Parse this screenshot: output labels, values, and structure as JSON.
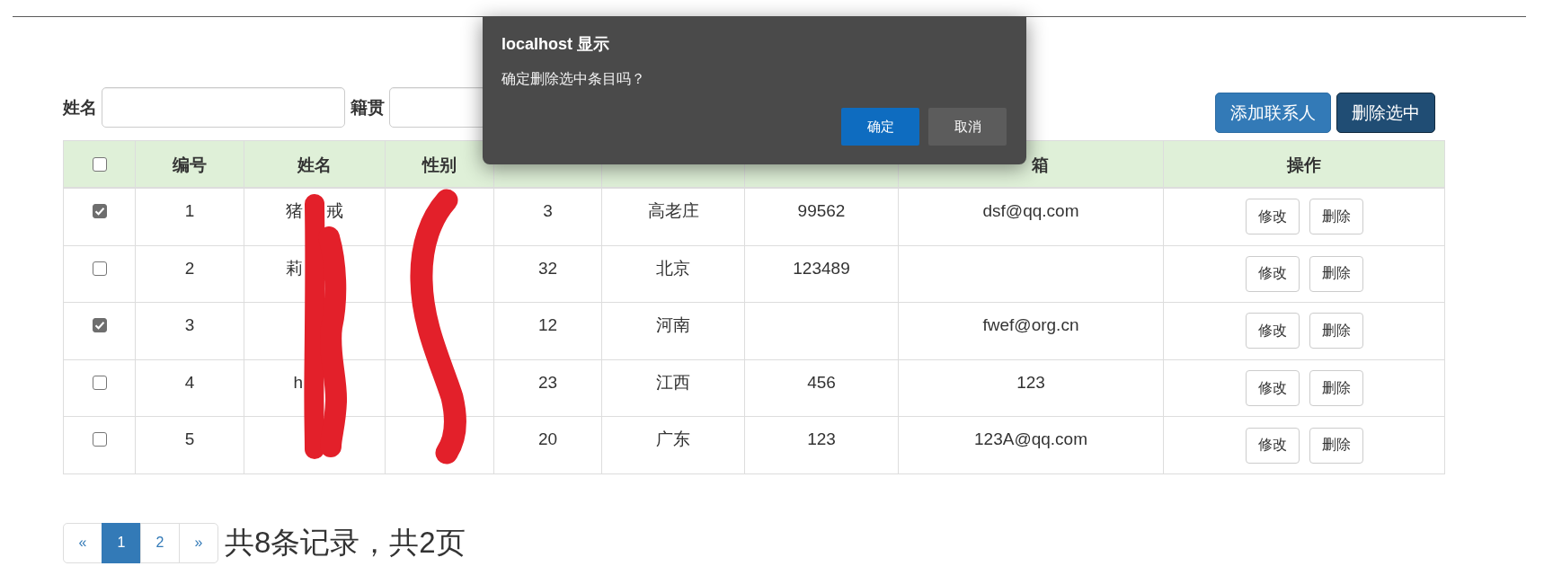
{
  "search_form": {
    "fields": [
      {
        "label": "姓名"
      },
      {
        "label": "籍贯"
      }
    ]
  },
  "toolbar": {
    "buttons": [
      {
        "label": "添加联系人",
        "pressed": false
      },
      {
        "label": "删除选中",
        "pressed": true
      }
    ]
  },
  "table": {
    "columns": [
      {
        "kind": "checkbox",
        "checked": false,
        "redacted": false
      },
      {
        "kind": "text",
        "label": "编号",
        "redacted": false
      },
      {
        "kind": "text",
        "label": "姓名",
        "redacted": true
      },
      {
        "kind": "text",
        "label": "性别",
        "redacted": true
      },
      {
        "kind": "text",
        "redacted": false
      },
      {
        "kind": "text",
        "redacted": false
      },
      {
        "kind": "text",
        "redacted": false
      },
      {
        "kind": "text",
        "label": "箱",
        "redacted": false
      },
      {
        "kind": "text",
        "label": "操作",
        "redacted": false
      }
    ],
    "rows": [
      {
        "selected": true,
        "number": "1",
        "name": {
          "visible_left": "猪",
          "visible_right": "戒"
        },
        "age": "3",
        "hometown": "高老庄",
        "qq": "99562",
        "email": "dsf@qq.com",
        "actions": [
          "修改",
          "删除"
        ]
      },
      {
        "selected": false,
        "number": "2",
        "name": {
          "visible_left": "莉"
        },
        "age": "32",
        "hometown": "北京",
        "qq": "123489",
        "actions": [
          "修改",
          "删除"
        ]
      },
      {
        "selected": true,
        "number": "3",
        "age": "12",
        "hometown": "河南",
        "email": "fwef@org.cn",
        "actions": [
          "修改",
          "删除"
        ]
      },
      {
        "selected": false,
        "number": "4",
        "name": {
          "visible_left": "h"
        },
        "age": "23",
        "hometown": "江西",
        "qq": "456",
        "email": "123",
        "actions": [
          "修改",
          "删除"
        ]
      },
      {
        "selected": false,
        "number": "5",
        "age": "20",
        "hometown": "广东",
        "qq": "123",
        "email": "123A@qq.com",
        "actions": [
          "修改",
          "删除"
        ]
      }
    ]
  },
  "pagination": {
    "previous": "«",
    "pages": [
      {
        "label": "1",
        "selected": true
      },
      {
        "label": "2",
        "selected": false
      }
    ],
    "next": "»",
    "summary": "共8条记录，共2页"
  },
  "dialog": {
    "title": "localhost 显示",
    "message": "确定删除选中条目吗？",
    "buttons": [
      {
        "label": "确定",
        "kind": "primary"
      },
      {
        "label": "取消",
        "kind": "secondary"
      }
    ]
  }
}
